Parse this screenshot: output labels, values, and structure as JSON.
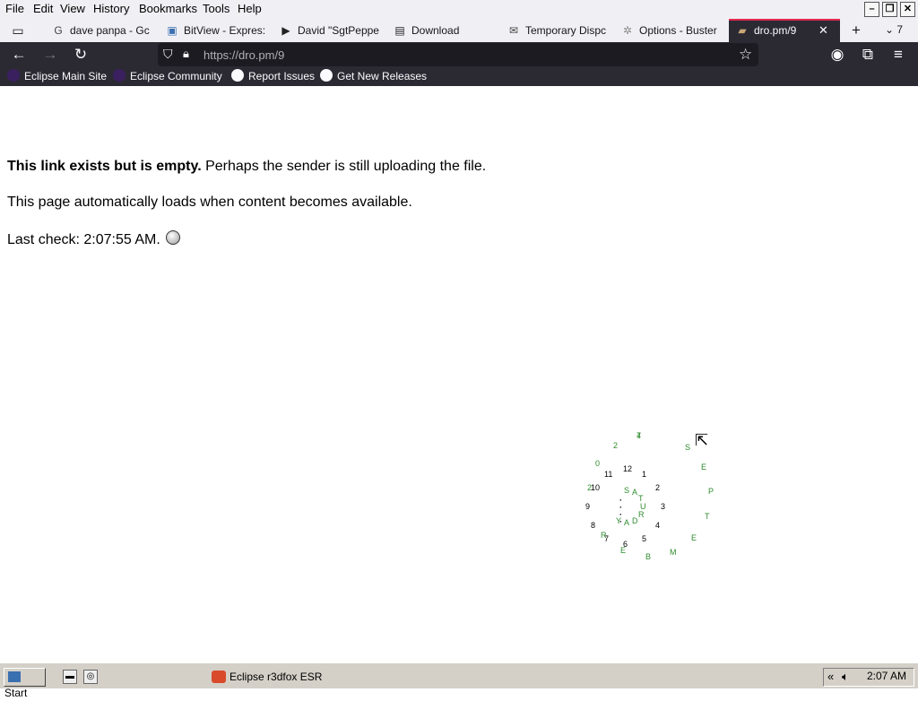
{
  "menubar": {
    "items": [
      "File",
      "Edit",
      "View",
      "History",
      "Bookmarks",
      "Tools",
      "Help"
    ],
    "window_controls": [
      "–",
      "❐",
      "✕"
    ]
  },
  "tabs": [
    {
      "label": "dave panpa - Gc",
      "icon": "google-icon"
    },
    {
      "label": "BitView - Expres:",
      "icon": "bitview-icon"
    },
    {
      "label": "David \"SgtPeppe",
      "icon": "youtube-icon"
    },
    {
      "label": "Download",
      "icon": "download-site-icon"
    },
    {
      "label": "Temporary Dispc",
      "icon": "mail-icon"
    },
    {
      "label": "Options - Buster",
      "icon": "puzzle-icon"
    },
    {
      "label": "dro.pm/9",
      "icon": "folder-icon",
      "active": true
    }
  ],
  "tab_extra": {
    "new_tab": "+",
    "overflow_count": "7"
  },
  "nav": {
    "url": "https://dro.pm/9"
  },
  "bookmarks": [
    {
      "label": "Eclipse Main Site",
      "icon": "eclipse-icon"
    },
    {
      "label": "Eclipse Community",
      "icon": "eclipse-icon"
    },
    {
      "label": "Report Issues",
      "icon": "github-icon"
    },
    {
      "label": "Get New Releases",
      "icon": "github-icon"
    }
  ],
  "content": {
    "line1_bold": "This link exists but is empty.",
    "line1_rest": " Perhaps the sender is still uploading the file.",
    "line2": "This page automatically loads when content becomes available.",
    "line3": "Last check: 2:07:55 AM."
  },
  "clock": {
    "hours": [
      "12",
      "1",
      "2",
      "3",
      "4",
      "5",
      "6",
      "7",
      "8",
      "9",
      "10",
      "11"
    ],
    "month": "SEPTEMBER",
    "day": "7",
    "weekday": "SATURDAY",
    "year": "2024"
  },
  "taskbar": {
    "start": "Start",
    "task": "Eclipse r3dfox ESR",
    "time": "2:07 AM"
  }
}
